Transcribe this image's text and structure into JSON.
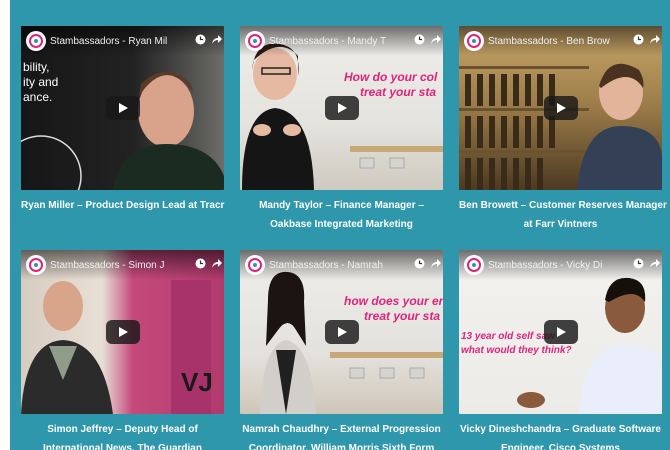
{
  "channel_name": "Stambassadors",
  "videos": [
    {
      "channel_title": "Stambassadors - Ryan Mil",
      "caption_line1": "Ryan Miller – Product Design Lead at Tracr",
      "caption_line2": "",
      "overlay": [
        "bility,",
        "ity and",
        "ance."
      ]
    },
    {
      "channel_title": "Stambassadors - Mandy T",
      "caption_line1": "Mandy Taylor – Finance Manager –",
      "caption_line2": "Oakbase Integrated Marketing",
      "overlay": [
        "How do your col",
        "treat your sta"
      ]
    },
    {
      "channel_title": "Stambassadors - Ben Brow",
      "caption_line1": "Ben Browett – Customer Reserves Manager",
      "caption_line2": "at Farr Vintners",
      "overlay": []
    },
    {
      "channel_title": "Stambassadors - Simon J",
      "caption_line1": "Simon Jeffrey – Deputy Head of",
      "caption_line2": "International News, The Guardian",
      "overlay": [
        "VJ"
      ]
    },
    {
      "channel_title": "Stambassadors - Namrah",
      "caption_line1": "Namrah Chaudhry – External Progression",
      "caption_line2": "Coordinator, William Morris Sixth Form",
      "overlay": [
        "how does your en",
        "treat your sta"
      ]
    },
    {
      "channel_title": "Stambassadors - Vicky Di",
      "caption_line1": "Vicky Dineshchandra – Graduate Software",
      "caption_line2": "Engineer, Cisco Systems",
      "overlay": [
        "13 year old self saw",
        "what would they think?"
      ]
    }
  ],
  "colors": {
    "background": "#2f97ab",
    "accent_pink": "#e0237d",
    "caption_text": "#ffffff"
  },
  "icons": [
    "stambassadors-logo-icon",
    "clock-icon",
    "share-icon",
    "play-icon"
  ]
}
